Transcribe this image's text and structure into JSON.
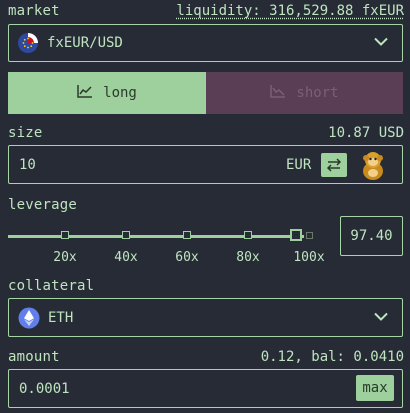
{
  "market": {
    "label": "market",
    "liquidity": "liquidity: 316,529.88 fxEUR",
    "selected": "fxEUR/USD",
    "icon": "eu-flag-icon"
  },
  "side": {
    "long_label": "long",
    "short_label": "short",
    "active": "long"
  },
  "size": {
    "label": "size",
    "usd_value": "10.87 USD",
    "input_value": "10",
    "unit": "EUR"
  },
  "leverage": {
    "label": "leverage",
    "value": "97.40",
    "ticks": [
      "20x",
      "40x",
      "60x",
      "80x",
      "100x"
    ],
    "fraction": 0.974
  },
  "collateral": {
    "label": "collateral",
    "selected": "ETH",
    "icon": "ethereum-icon"
  },
  "amount": {
    "label": "amount",
    "balance": "0.12, bal: 0.0410",
    "input_value": "0.0001",
    "max_label": "max"
  },
  "colors": {
    "background": "#262b36",
    "accent": "#9ed09e",
    "short": "#5a3e56"
  }
}
